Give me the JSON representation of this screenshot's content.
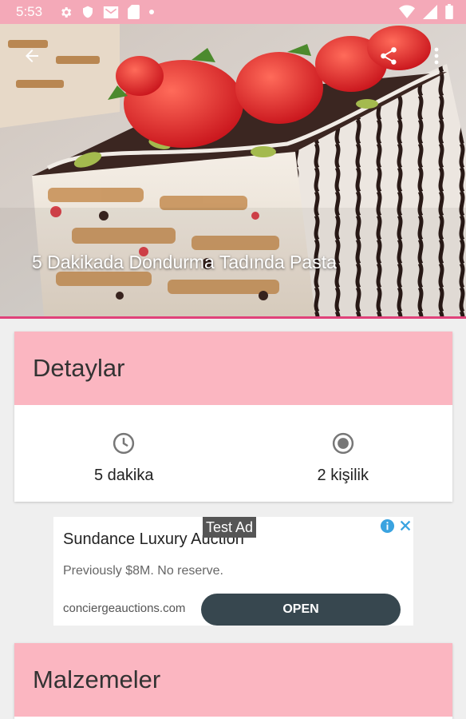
{
  "status_bar": {
    "time": "5:53",
    "left_icons": [
      "gear-icon",
      "shield-icon",
      "mail-icon",
      "sd-card-icon",
      "dot-icon"
    ],
    "right_icons": [
      "wifi-icon",
      "signal-icon",
      "battery-icon"
    ]
  },
  "toolbar": {
    "back_icon": "arrow-left-icon",
    "share_icon": "share-icon",
    "menu_icon": "more-vert-icon"
  },
  "recipe": {
    "title": "5 Dakikada Dondurma Tadında Pasta"
  },
  "details": {
    "header": "Detaylar",
    "time_icon": "clock-icon",
    "time": "5 dakika",
    "servings_icon": "radio-button-icon",
    "servings": "2 kişilik"
  },
  "ad": {
    "badge": "Test Ad",
    "title": "Sundance Luxury Auction",
    "description": "Previously $8M. No reserve.",
    "domain": "conciergeauctions.com",
    "cta": "OPEN"
  },
  "ingredients": {
    "header": "Malzemeler"
  },
  "colors": {
    "status_bar": "#f4a9b8",
    "card_header": "#fbb6c1",
    "accent_line": "#e0427a",
    "ad_button": "#37474f"
  }
}
